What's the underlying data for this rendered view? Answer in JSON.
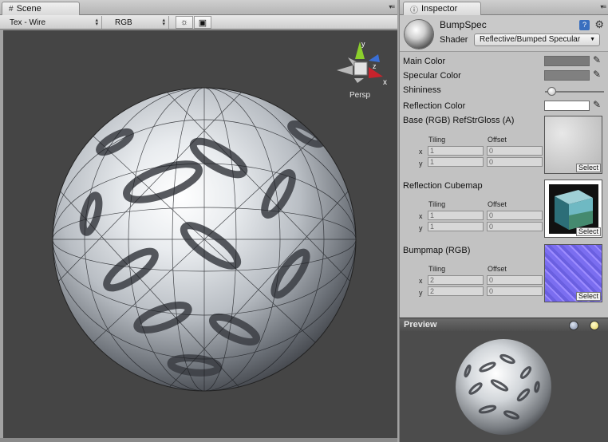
{
  "scene": {
    "tab_label": "Scene",
    "tab_icon": "grid-icon",
    "toolbar": {
      "render_mode": "Tex - Wire",
      "channel_mode": "RGB",
      "lighting_icon": "sun-icon",
      "image_icon": "image-icon"
    },
    "gizmo": {
      "axis_x": "x",
      "axis_y": "y",
      "axis_z": "z",
      "projection": "Persp"
    }
  },
  "inspector": {
    "tab_label": "Inspector",
    "tab_icon": "info-icon",
    "material_name": "BumpSpec",
    "shader_label": "Shader",
    "shader_value": "Reflective/Bumped Specular",
    "properties": {
      "main_color": "Main Color",
      "specular_color": "Specular Color",
      "shininess": "Shininess",
      "reflection_color": "Reflection Color",
      "shininess_value": 0.07
    },
    "textures": [
      {
        "label": "Base (RGB) RefStrGloss (A)",
        "tiling_label": "Tiling",
        "offset_label": "Offset",
        "x_label": "x",
        "y_label": "y",
        "tiling_x": "1",
        "tiling_y": "1",
        "offset_x": "0",
        "offset_y": "0",
        "select": "Select"
      },
      {
        "label": "Reflection Cubemap",
        "tiling_label": "Tiling",
        "offset_label": "Offset",
        "x_label": "x",
        "y_label": "y",
        "tiling_x": "1",
        "tiling_y": "1",
        "offset_x": "0",
        "offset_y": "0",
        "select": "Select"
      },
      {
        "label": "Bumpmap (RGB)",
        "tiling_label": "Tiling",
        "offset_label": "Offset",
        "x_label": "x",
        "y_label": "y",
        "tiling_x": "2",
        "tiling_y": "2",
        "offset_x": "0",
        "offset_y": "0",
        "select": "Select"
      }
    ],
    "colors": {
      "main_color": "#7a7a7a",
      "specular_color": "#808080",
      "reflection_color": "#ffffff"
    }
  },
  "preview": {
    "title": "Preview"
  }
}
